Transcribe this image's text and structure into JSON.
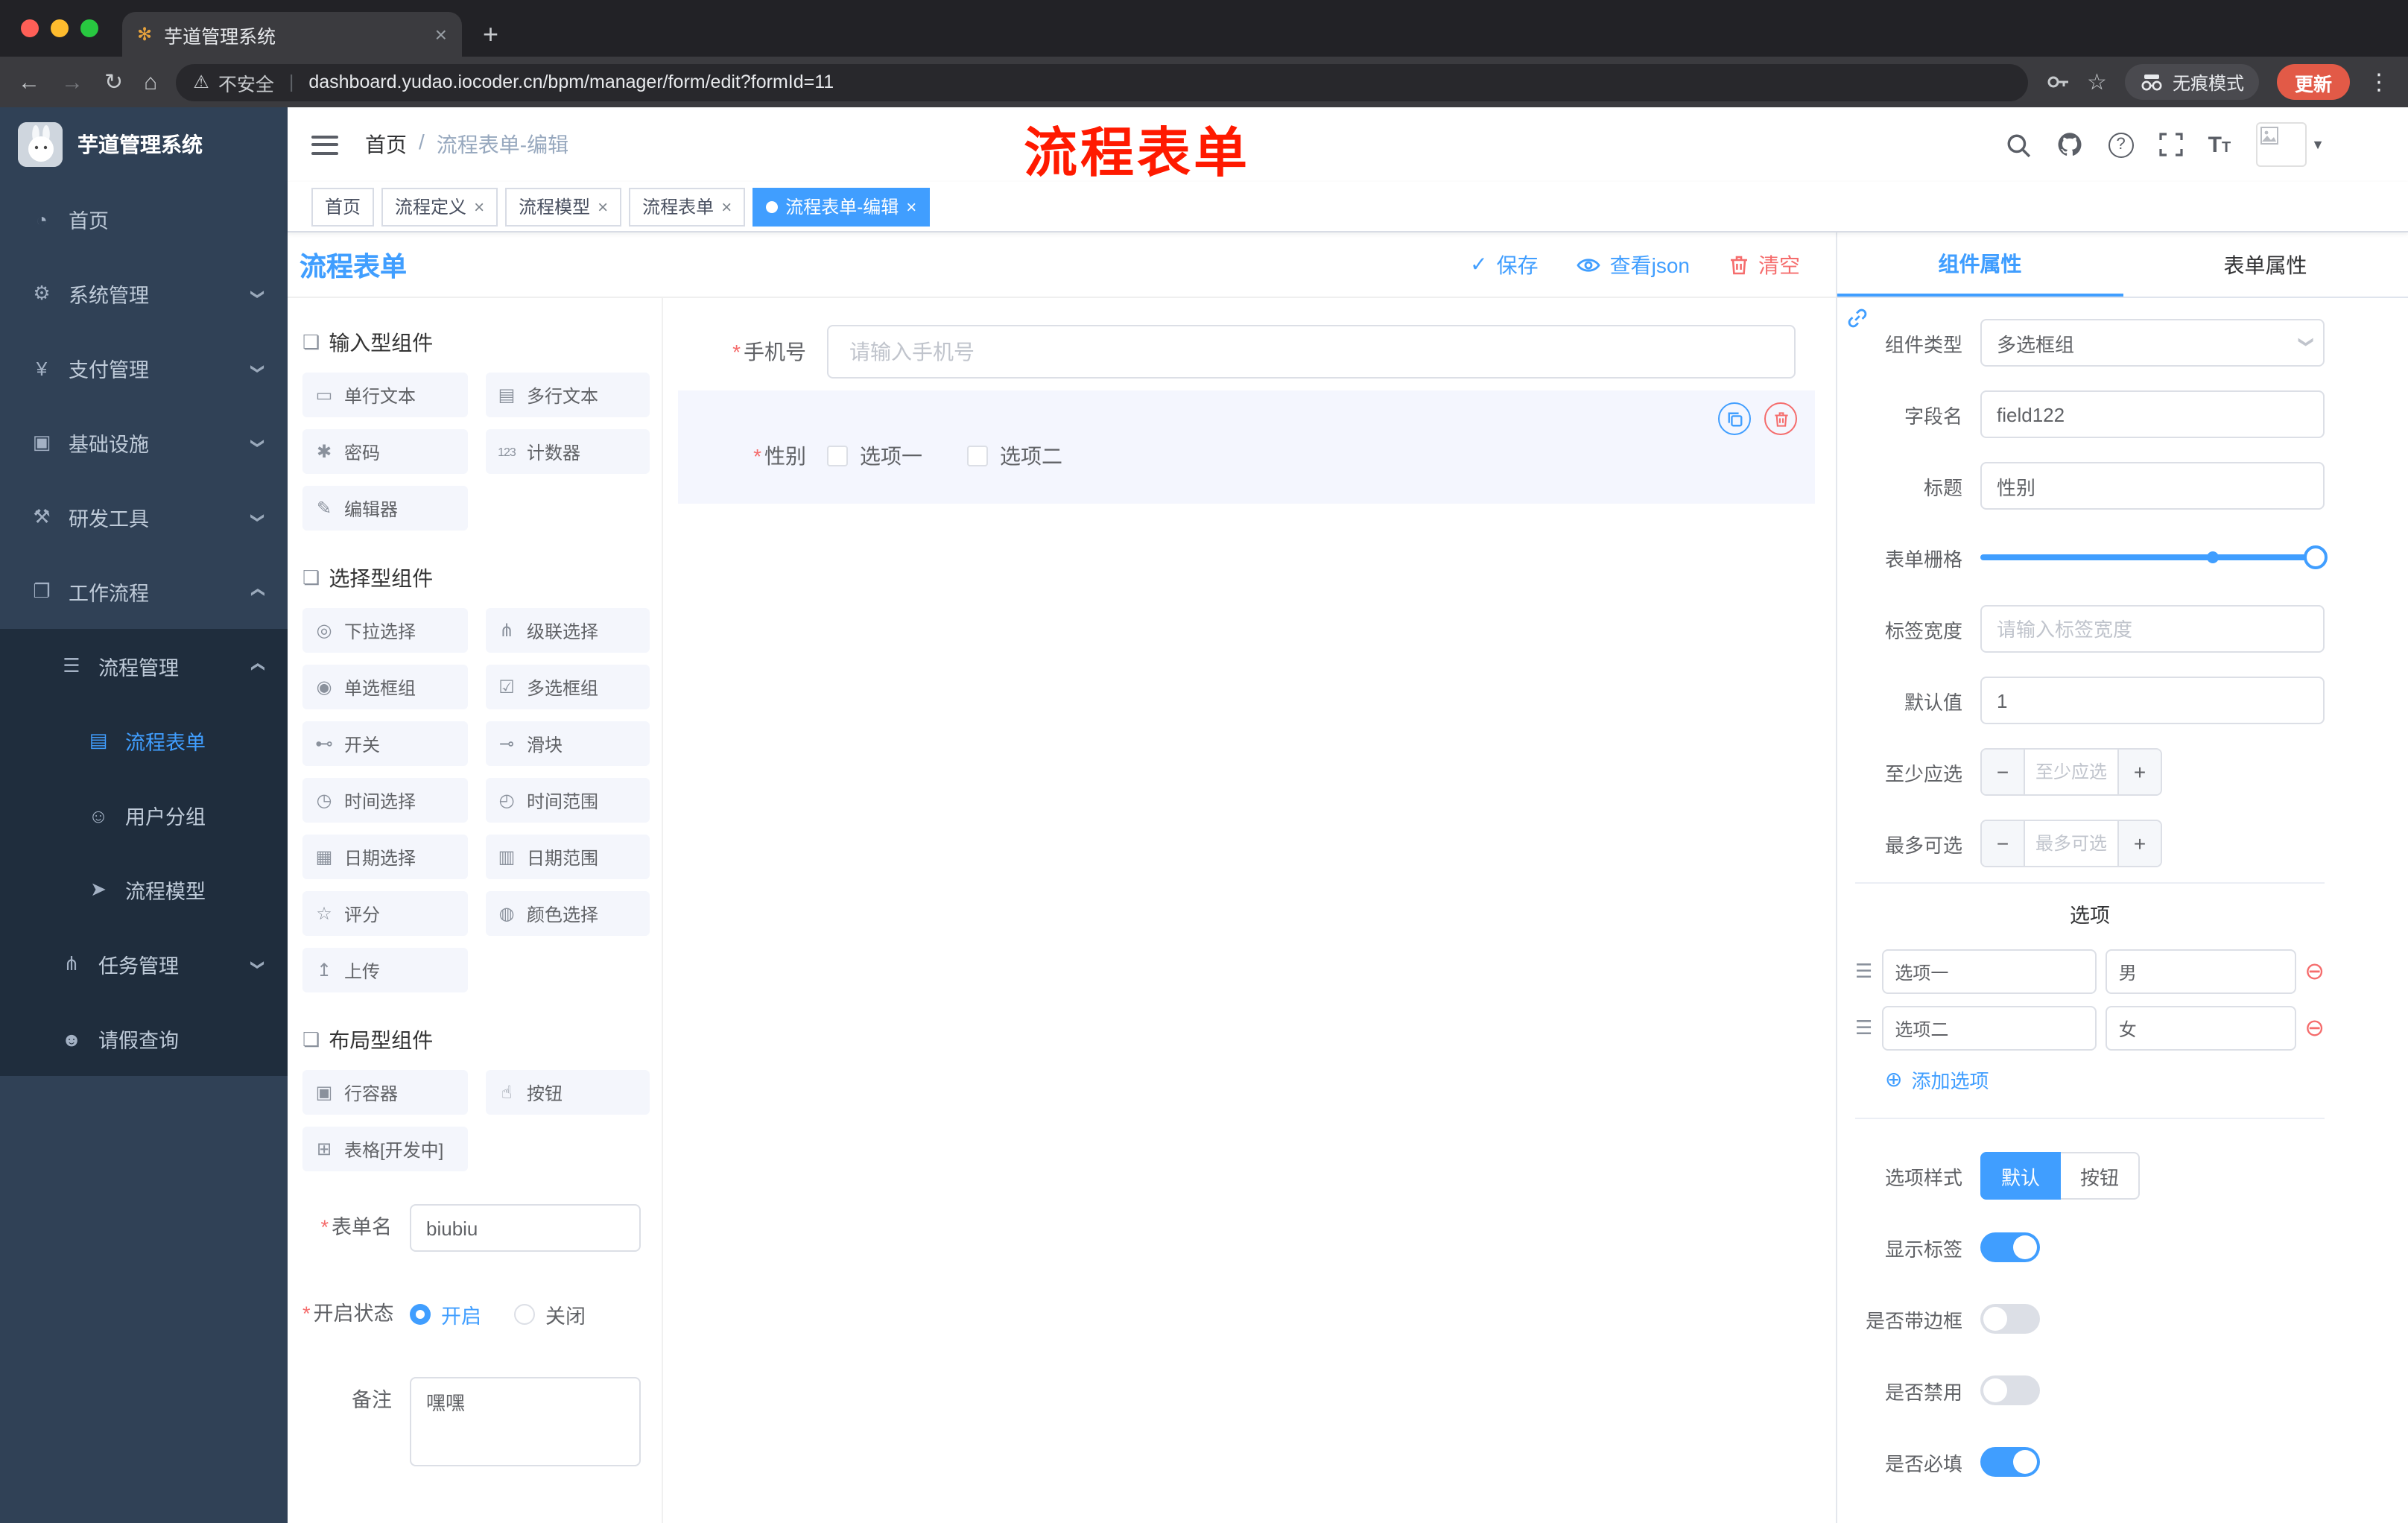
{
  "colors": {
    "accent": "#409eff",
    "danger": "#f56c6c",
    "annotation_red": "#ff1a00",
    "sidebar_bg": "#304156",
    "submenu_bg": "#1f2d3d"
  },
  "browser": {
    "tab_title": "芋道管理系统",
    "security": "不安全",
    "url": "dashboard.yudao.iocoder.cn/bpm/manager/form/edit?formId=11",
    "incognito_label": "无痕模式",
    "update_label": "更新"
  },
  "annotation": "流程表单",
  "header": {
    "logo_title": "芋道管理系统",
    "breadcrumb": {
      "home": "首页",
      "sep": "/",
      "current": "流程表单-编辑"
    }
  },
  "tags": [
    {
      "label": "首页"
    },
    {
      "label": "流程定义"
    },
    {
      "label": "流程模型"
    },
    {
      "label": "流程表单"
    },
    {
      "label": "流程表单-编辑"
    }
  ],
  "menu": [
    {
      "label": "首页",
      "icon": "dashboard-icon",
      "glyph": "◔"
    },
    {
      "label": "系统管理",
      "icon": "gear-icon",
      "glyph": "⚙"
    },
    {
      "label": "支付管理",
      "icon": "payment-icon",
      "glyph": "¥"
    },
    {
      "label": "基础设施",
      "icon": "infrastructure-icon",
      "glyph": "▣"
    },
    {
      "label": "研发工具",
      "icon": "devtools-icon",
      "glyph": "⚒"
    },
    {
      "label": "工作流程",
      "icon": "workflow-icon",
      "glyph": "❐"
    },
    {
      "label": "流程管理",
      "icon": "process-management-icon",
      "glyph": "☰"
    },
    {
      "label": "流程表单",
      "icon": "process-form-icon",
      "glyph": "▤"
    },
    {
      "label": "用户分组",
      "icon": "user-group-icon",
      "glyph": "☺"
    },
    {
      "label": "流程模型",
      "icon": "process-model-icon",
      "glyph": "➤"
    },
    {
      "label": "任务管理",
      "icon": "task-management-icon",
      "glyph": "⋔"
    },
    {
      "label": "请假查询",
      "icon": "leave-query-icon",
      "glyph": "☻"
    }
  ],
  "designer": {
    "title": "流程表单",
    "save": "保存",
    "view_json": "查看json",
    "clear": "清空"
  },
  "palette": {
    "groups": [
      {
        "title": "输入型组件",
        "items": [
          {
            "label": "单行文本",
            "icon": "single-line-text-icon",
            "glyph": "▭"
          },
          {
            "label": "多行文本",
            "icon": "multi-line-text-icon",
            "glyph": "▤"
          },
          {
            "label": "密码",
            "icon": "password-icon",
            "glyph": "✱"
          },
          {
            "label": "计数器",
            "icon": "counter-icon",
            "glyph": "123"
          },
          {
            "label": "编辑器",
            "icon": "editor-icon",
            "glyph": "✎"
          }
        ]
      },
      {
        "title": "选择型组件",
        "items": [
          {
            "label": "下拉选择",
            "icon": "select-icon",
            "glyph": "◎"
          },
          {
            "label": "级联选择",
            "icon": "cascader-icon",
            "glyph": "⋔"
          },
          {
            "label": "单选框组",
            "icon": "radio-group-icon",
            "glyph": "◉"
          },
          {
            "label": "多选框组",
            "icon": "checkbox-group-icon",
            "glyph": "☑"
          },
          {
            "label": "开关",
            "icon": "switch-icon",
            "glyph": "⊷"
          },
          {
            "label": "滑块",
            "icon": "slider-icon",
            "glyph": "⊸"
          },
          {
            "label": "时间选择",
            "icon": "time-picker-icon",
            "glyph": "◷"
          },
          {
            "label": "时间范围",
            "icon": "time-range-icon",
            "glyph": "◴"
          },
          {
            "label": "日期选择",
            "icon": "date-picker-icon",
            "glyph": "▦"
          },
          {
            "label": "日期范围",
            "icon": "date-range-icon",
            "glyph": "▥"
          },
          {
            "label": "评分",
            "icon": "rate-icon",
            "glyph": "☆"
          },
          {
            "label": "颜色选择",
            "icon": "color-picker-icon",
            "glyph": "◍"
          },
          {
            "label": "上传",
            "icon": "upload-icon",
            "glyph": "↥"
          }
        ]
      },
      {
        "title": "布局型组件",
        "items": [
          {
            "label": "行容器",
            "icon": "row-container-icon",
            "glyph": "▣"
          },
          {
            "label": "按钮",
            "icon": "button-icon",
            "glyph": "☝"
          },
          {
            "label": "表格[开发中]",
            "icon": "table-icon",
            "glyph": "⊞"
          }
        ]
      }
    ]
  },
  "meta": {
    "name_label": "表单名",
    "name_value": "biubiu",
    "status_label": "开启状态",
    "status_on": "开启",
    "status_off": "关闭",
    "remark_label": "备注",
    "remark_value": "嘿嘿"
  },
  "canvas": {
    "phone_label": "手机号",
    "phone_placeholder": "请输入手机号",
    "gender_label": "性别",
    "gender_options": [
      {
        "label": "选项一"
      },
      {
        "label": "选项二"
      }
    ]
  },
  "props": {
    "tab_component": "组件属性",
    "tab_form": "表单属性",
    "component_type_label": "组件类型",
    "component_type_value": "多选框组",
    "field_name_label": "字段名",
    "field_name_value": "field122",
    "title_label": "标题",
    "title_value": "性别",
    "grid_label": "表单栅格",
    "label_width_label": "标签宽度",
    "label_width_placeholder": "请输入标签宽度",
    "default_label": "默认值",
    "default_value": "1",
    "min_label": "至少应选",
    "min_placeholder": "至少应选",
    "max_label": "最多可选",
    "max_placeholder": "最多可选",
    "options_title": "选项",
    "option_rows": [
      {
        "label": "选项一",
        "value": "男"
      },
      {
        "label": "选项二",
        "value": "女"
      }
    ],
    "add_option": "添加选项",
    "style_label": "选项样式",
    "style_default": "默认",
    "style_button": "按钮",
    "switches": [
      {
        "label": "显示标签",
        "on": true
      },
      {
        "label": "是否带边框",
        "on": false
      },
      {
        "label": "是否禁用",
        "on": false
      },
      {
        "label": "是否必填",
        "on": true
      }
    ]
  }
}
